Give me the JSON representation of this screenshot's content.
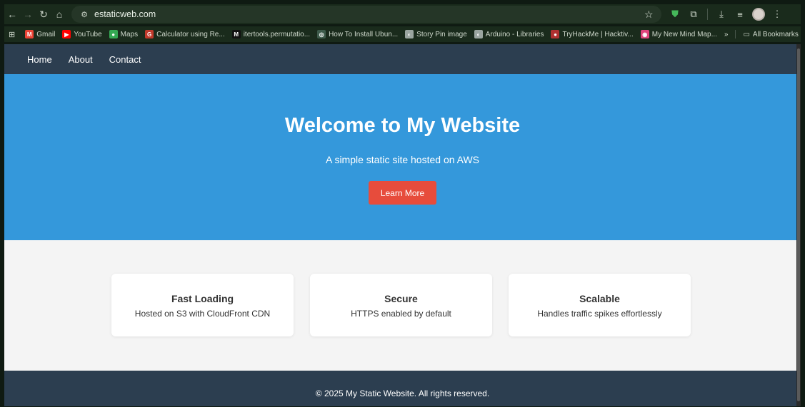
{
  "browser": {
    "url": "estaticweb.com",
    "nav_icons": [
      "back-icon",
      "forward-icon",
      "reload-icon",
      "home-icon"
    ],
    "bookmarks": [
      {
        "label": "Gmail",
        "color": "#ea4335",
        "glyph": "M"
      },
      {
        "label": "YouTube",
        "color": "#ff0000",
        "glyph": "▶"
      },
      {
        "label": "Maps",
        "color": "#34a853",
        "glyph": "●"
      },
      {
        "label": "Calculator using Re...",
        "color": "#c0392b",
        "glyph": "G"
      },
      {
        "label": "itertools.permutatio...",
        "color": "#111111",
        "glyph": "M"
      },
      {
        "label": "How To Install Ubun...",
        "color": "#3d5a4a",
        "glyph": "◎"
      },
      {
        "label": "Story Pin image",
        "color": "#9aa5a0",
        "glyph": "◐"
      },
      {
        "label": "Arduino - Libraries",
        "color": "#9aa5a0",
        "glyph": "◐"
      },
      {
        "label": "TryHackMe | Hacktiv...",
        "color": "#b03030",
        "glyph": "●"
      },
      {
        "label": "My New Mind Map...",
        "color": "#e0457b",
        "glyph": "◉"
      }
    ],
    "more_bookmarks": "»",
    "all_bookmarks": "All Bookmarks"
  },
  "nav": {
    "links": [
      "Home",
      "About",
      "Contact"
    ]
  },
  "hero": {
    "title": "Welcome to My Website",
    "subtitle": "A simple static site hosted on AWS",
    "cta": "Learn More"
  },
  "features": [
    {
      "title": "Fast Loading",
      "desc": "Hosted on S3 with CloudFront CDN"
    },
    {
      "title": "Secure",
      "desc": "HTTPS enabled by default"
    },
    {
      "title": "Scalable",
      "desc": "Handles traffic spikes effortlessly"
    }
  ],
  "footer": {
    "text": "© 2025 My Static Website. All rights reserved."
  },
  "colors": {
    "nav_bg": "#2c3e50",
    "hero_bg": "#3498db",
    "cta_bg": "#e74c3c",
    "features_bg": "#f4f4f4"
  }
}
